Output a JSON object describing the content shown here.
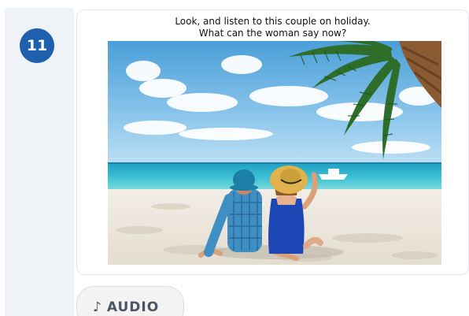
{
  "question": {
    "number": "11",
    "prompt_line1": "Look, and listen to this couple on holiday.",
    "prompt_line2": "What can the woman say now?"
  },
  "image": {
    "description": "couple sitting on a tropical beach under a palm tree"
  },
  "audio_button": {
    "icon": "♪",
    "label": "AUDIO"
  },
  "colors": {
    "badge": "#1e5fae",
    "rail": "#eff3f8",
    "button_bg": "#f3f3f3"
  }
}
